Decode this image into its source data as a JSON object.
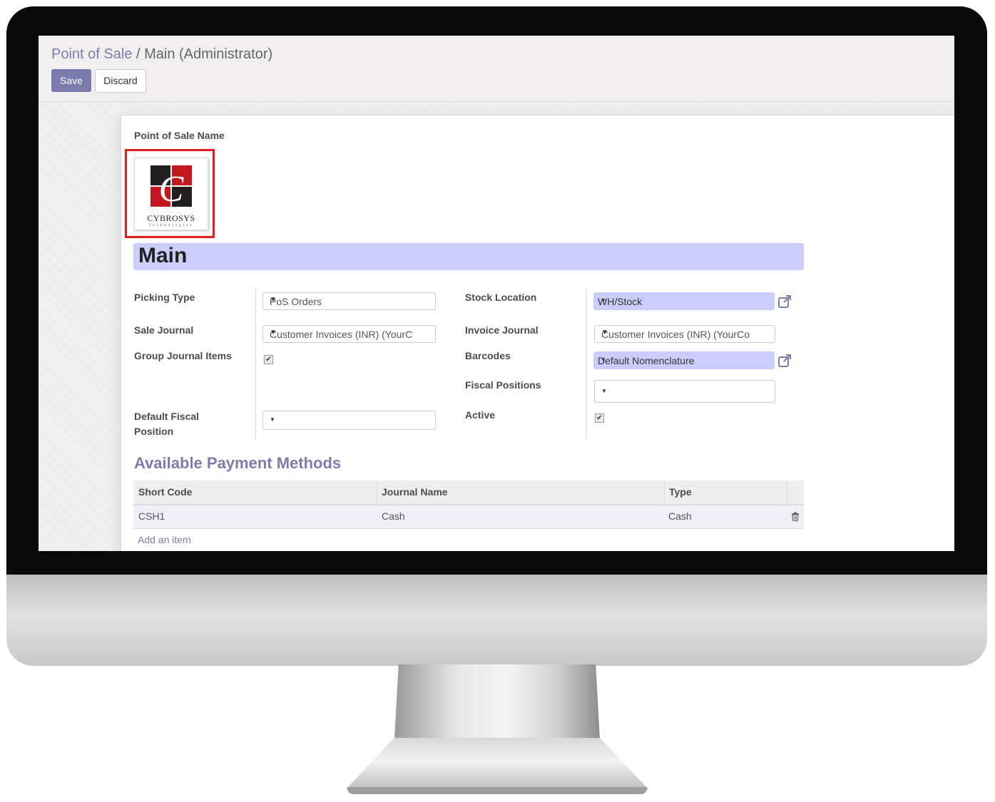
{
  "breadcrumb": {
    "parent": "Point of Sale",
    "separator": "/",
    "current": "Main (Administrator)"
  },
  "buttons": {
    "save": "Save",
    "discard": "Discard"
  },
  "form": {
    "pos_name_label": "Point of Sale Name",
    "logo": {
      "name": "CYBROSYS",
      "tagline": "Technologies"
    },
    "name_value": "Main",
    "picking_type": {
      "label": "Picking Type",
      "value": "PoS Orders"
    },
    "sale_journal": {
      "label": "Sale Journal",
      "value": "Customer Invoices (INR) (YourC"
    },
    "group_journal_items": {
      "label": "Group Journal Items",
      "checked": true
    },
    "default_fiscal_position": {
      "label_line1": "Default Fiscal",
      "label_line2": "Position",
      "value": ""
    },
    "stock_location": {
      "label": "Stock Location",
      "value": "WH/Stock"
    },
    "invoice_journal": {
      "label": "Invoice Journal",
      "value": "Customer Invoices (INR) (YourCo"
    },
    "barcodes": {
      "label": "Barcodes",
      "value": "Default Nomenclature"
    },
    "fiscal_positions": {
      "label": "Fiscal Positions",
      "value": ""
    },
    "active": {
      "label": "Active",
      "checked": true
    }
  },
  "payment_methods": {
    "title": "Available Payment Methods",
    "columns": [
      "Short Code",
      "Journal Name",
      "Type"
    ],
    "rows": [
      {
        "short_code": "CSH1",
        "journal_name": "Cash",
        "type": "Cash"
      }
    ],
    "add_item": "Add an item"
  },
  "icons": {
    "checkbox": "✔",
    "caret": "▼",
    "external_link": "external-link-icon",
    "trash": "trash-icon"
  },
  "colors": {
    "accent": "#7c7bad",
    "required_field": "#cccdfb",
    "highlight_border": "#e31b1b",
    "logo_red": "#c4161c",
    "logo_dark": "#231f20"
  }
}
